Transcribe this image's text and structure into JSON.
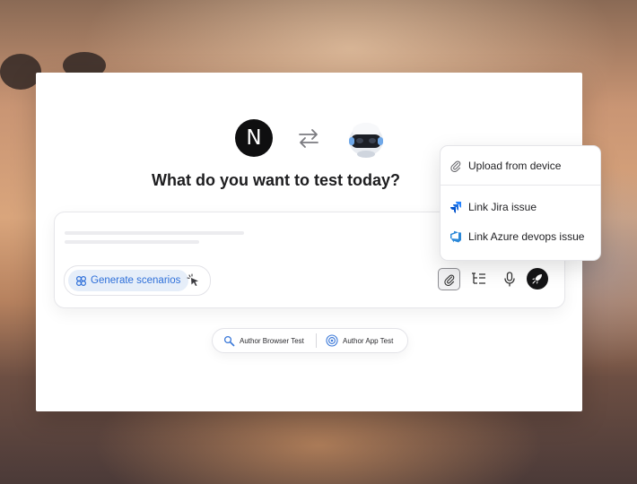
{
  "header": {
    "heading": "What do you want to test today?"
  },
  "logos": {
    "left_logo_letter": "N",
    "swap_icon": "swap-arrows-icon",
    "right_logo": "robot-mascot"
  },
  "composer": {
    "generate_label": "Generate scenarios",
    "generate_icon": "scenarios-icon",
    "cursor_icon": "pointer-click-icon",
    "tools": [
      "paperclip-icon",
      "list-tree-icon",
      "microphone-icon",
      "rocket-icon"
    ]
  },
  "author": {
    "browser_label": "Author Browser Test",
    "app_label": "Author App Test"
  },
  "menu": {
    "upload_label": "Upload from device",
    "jira_label": "Link Jira issue",
    "azure_label": "Link Azure devops issue"
  },
  "colors": {
    "accent_blue": "#2e6fd9",
    "dark": "#141416",
    "jira_blue": "#2684ff",
    "azure_blue": "#2b88d8"
  }
}
